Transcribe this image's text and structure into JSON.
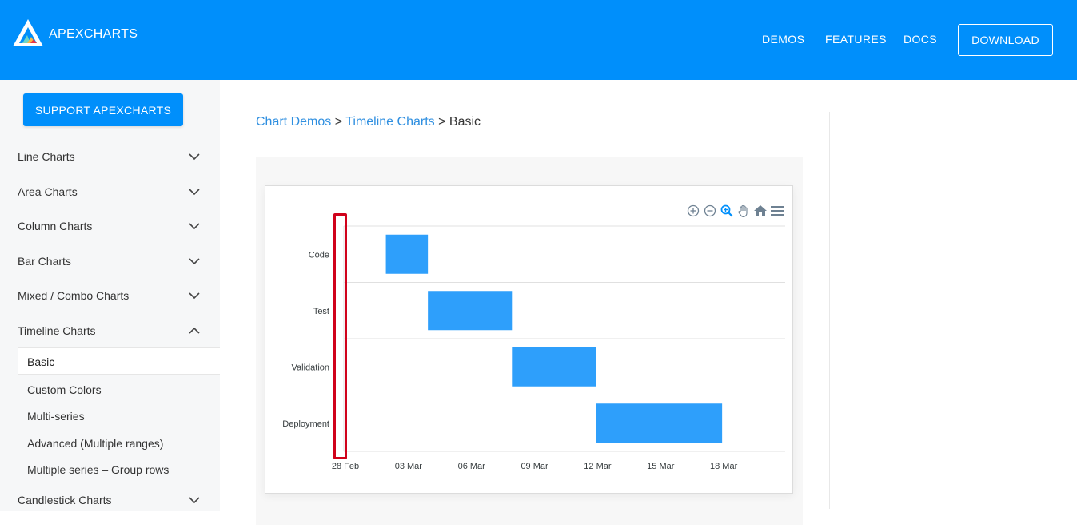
{
  "header": {
    "logo_text": "APEXCHARTS",
    "nav": [
      "DEMOS",
      "FEATURES",
      "DOCS"
    ],
    "download_label": "DOWNLOAD"
  },
  "sidebar": {
    "support_label": "SUPPORT APEXCHARTS",
    "groups": [
      {
        "label": "Line Charts",
        "expanded": false
      },
      {
        "label": "Area Charts",
        "expanded": false
      },
      {
        "label": "Column Charts",
        "expanded": false
      },
      {
        "label": "Bar Charts",
        "expanded": false
      },
      {
        "label": "Mixed / Combo Charts",
        "expanded": false
      },
      {
        "label": "Timeline Charts",
        "expanded": true
      }
    ],
    "sub_items": [
      "Basic",
      "Custom Colors",
      "Multi-series",
      "Advanced (Multiple ranges)",
      "Multiple series – Group rows"
    ],
    "last_group": {
      "label": "Candlestick Charts",
      "expanded": false
    }
  },
  "breadcrumb": {
    "link1": "Chart Demos",
    "sep": ">",
    "link2": "Timeline Charts",
    "current": "Basic"
  },
  "colors": {
    "brand": "#008ffb",
    "bar": "#2e9ffb",
    "highlight": "#d0021b"
  },
  "chart_data": {
    "type": "bar",
    "orientation": "horizontal-timeline",
    "categories": [
      "Code",
      "Test",
      "Validation",
      "Deployment"
    ],
    "series": [
      {
        "data": [
          {
            "x": "Code",
            "start": "2019-03-02",
            "end": "2019-03-04"
          },
          {
            "x": "Test",
            "start": "2019-03-04",
            "end": "2019-03-08"
          },
          {
            "x": "Validation",
            "start": "2019-03-08",
            "end": "2019-03-12"
          },
          {
            "x": "Deployment",
            "start": "2019-03-12",
            "end": "2019-03-18"
          }
        ]
      }
    ],
    "x_ticks": [
      "28 Feb",
      "03 Mar",
      "06 Mar",
      "09 Mar",
      "12 Mar",
      "15 Mar",
      "18 Mar"
    ],
    "xlim": [
      "2019-02-28",
      "2019-03-21"
    ],
    "grid": "horizontal lines"
  }
}
